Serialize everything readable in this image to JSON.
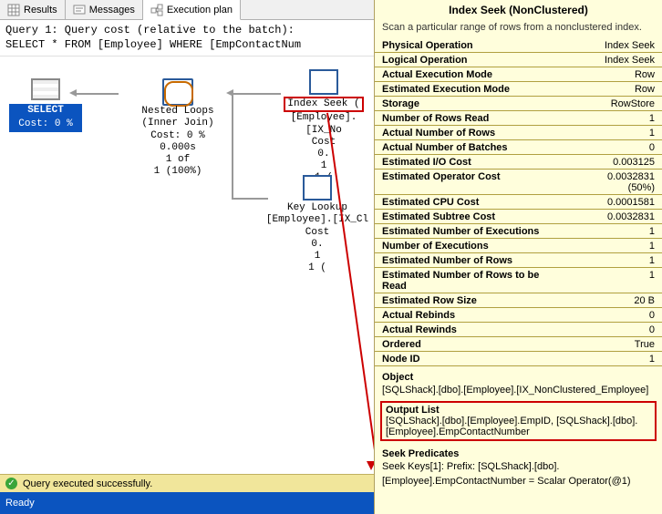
{
  "tabs": {
    "results": "Results",
    "messages": "Messages",
    "execplan": "Execution plan"
  },
  "query_header": {
    "line1": "Query 1: Query cost (relative to the batch):",
    "line2": "SELECT * FROM [Employee] WHERE [EmpContactNum"
  },
  "plan": {
    "select": {
      "label": "SELECT",
      "cost": "Cost: 0 %"
    },
    "loops": {
      "title": "Nested Loops",
      "sub": "(Inner Join)",
      "cost": "Cost: 0 %",
      "time": "0.000s",
      "rows": "1 of",
      "pct": "1 (100%)"
    },
    "seek": {
      "title": "Index Seek (",
      "obj": "[Employee].[IX_No",
      "cost": "Cost",
      "time": "0.",
      "rows": "1",
      "pct": "1 ("
    },
    "lookup": {
      "title": "Key Lookup",
      "obj": "[Employee].[IX_Cl",
      "cost": "Cost",
      "time": "0.",
      "rows": "1",
      "pct": "1 ("
    }
  },
  "tooltip": {
    "title": "Index Seek (NonClustered)",
    "desc": "Scan a particular range of rows from a nonclustered index.",
    "props": [
      {
        "k": "Physical Operation",
        "v": "Index Seek"
      },
      {
        "k": "Logical Operation",
        "v": "Index Seek"
      },
      {
        "k": "Actual Execution Mode",
        "v": "Row"
      },
      {
        "k": "Estimated Execution Mode",
        "v": "Row"
      },
      {
        "k": "Storage",
        "v": "RowStore"
      },
      {
        "k": "Number of Rows Read",
        "v": "1"
      },
      {
        "k": "Actual Number of Rows",
        "v": "1"
      },
      {
        "k": "Actual Number of Batches",
        "v": "0"
      },
      {
        "k": "Estimated I/O Cost",
        "v": "0.003125"
      },
      {
        "k": "Estimated Operator Cost",
        "v": "0.0032831 (50%)"
      },
      {
        "k": "Estimated CPU Cost",
        "v": "0.0001581"
      },
      {
        "k": "Estimated Subtree Cost",
        "v": "0.0032831"
      },
      {
        "k": "Estimated Number of Executions",
        "v": "1"
      },
      {
        "k": "Number of Executions",
        "v": "1"
      },
      {
        "k": "Estimated Number of Rows",
        "v": "1"
      },
      {
        "k": "Estimated Number of Rows to be Read",
        "v": "1"
      },
      {
        "k": "Estimated Row Size",
        "v": "20 B"
      },
      {
        "k": "Actual Rebinds",
        "v": "0"
      },
      {
        "k": "Actual Rewinds",
        "v": "0"
      },
      {
        "k": "Ordered",
        "v": "True"
      },
      {
        "k": "Node ID",
        "v": "1"
      }
    ],
    "object_label": "Object",
    "object_value": "[SQLShack].[dbo].[Employee].[IX_NonClustered_Employee]",
    "output_label": "Output List",
    "output_value": "[SQLShack].[dbo].[Employee].EmpID, [SQLShack].[dbo].[Employee].EmpContactNumber",
    "seekpred_label": "Seek Predicates",
    "seekpred_value1": "Seek Keys[1]: Prefix: [SQLShack].[dbo].",
    "seekpred_value2": "[Employee].EmpContactNumber = Scalar Operator(@1)"
  },
  "status": {
    "text": "Query executed successfully.",
    "ready": "Ready"
  }
}
